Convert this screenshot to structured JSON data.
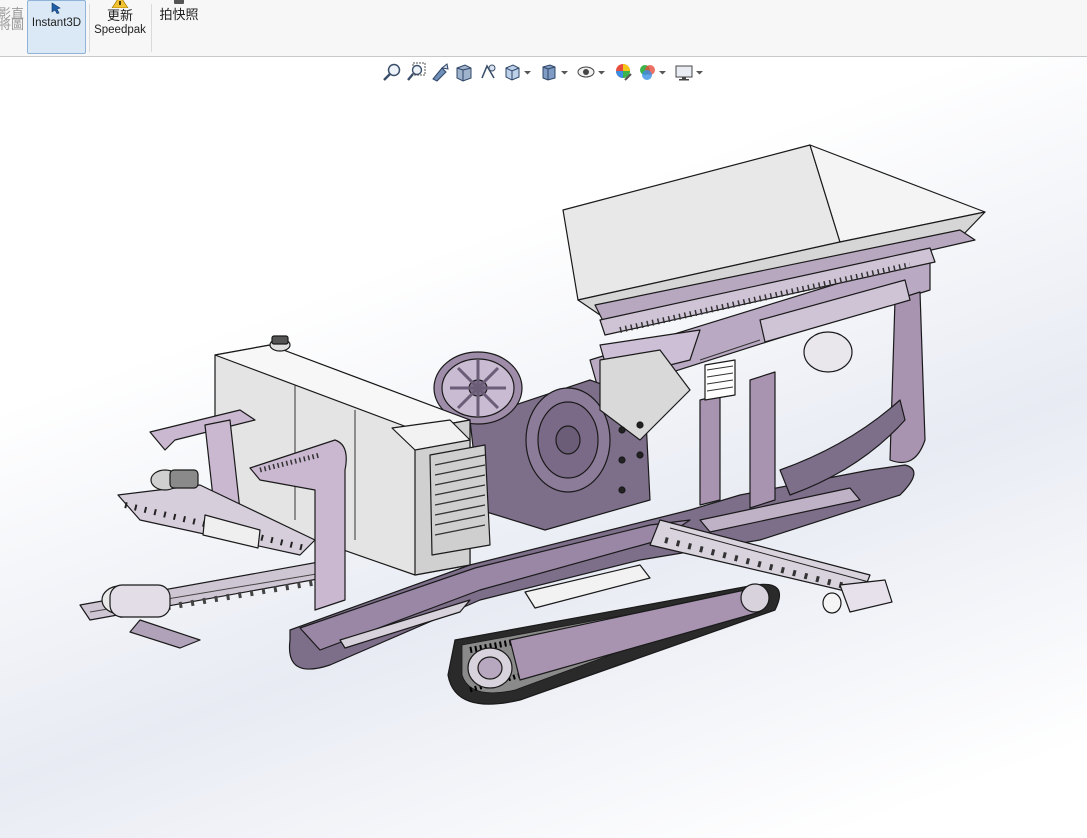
{
  "ribbon": {
    "cutoff_label": "影直\n將圖",
    "instant3d_label": "Instant3D",
    "speedpak_line1": "更新",
    "speedpak_line2": "Speedpak",
    "snapshot_label": "拍快照",
    "active_button": "Instant3D"
  },
  "hud_toolbar": {
    "items": [
      {
        "icon": "zoom-to-fit-icon",
        "dropdown": false
      },
      {
        "icon": "zoom-to-area-icon",
        "dropdown": false
      },
      {
        "icon": "previous-view-icon",
        "dropdown": false
      },
      {
        "icon": "section-view-icon",
        "dropdown": false
      },
      {
        "icon": "dynamic-annotation-icon",
        "dropdown": false
      },
      {
        "icon": "view-orientation-icon",
        "dropdown": true
      },
      {
        "icon": "display-style-icon",
        "dropdown": true
      },
      {
        "icon": "hide-show-items-icon",
        "dropdown": true
      },
      {
        "icon": "edit-appearance-icon",
        "dropdown": false
      },
      {
        "icon": "apply-scene-icon",
        "dropdown": true
      },
      {
        "icon": "view-settings-icon",
        "dropdown": true
      }
    ]
  },
  "viewport": {
    "model": "mobile jaw crusher on crawler tracks",
    "colors": {
      "body": "#a894b0",
      "body_light": "#c9b8cf",
      "frame_dark": "#7d6e8a",
      "panel": "#e6e6e6",
      "outline": "#1a1a1a",
      "background_tint": "#e8ebf3"
    }
  }
}
